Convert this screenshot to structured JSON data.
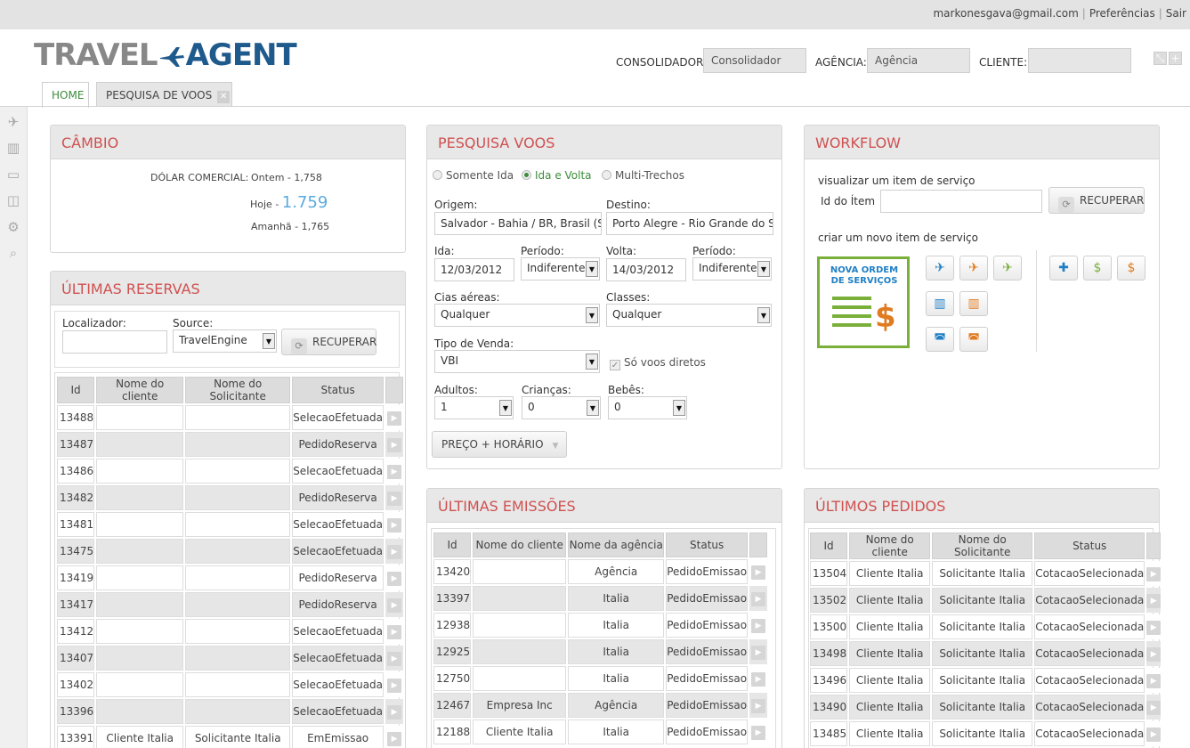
{
  "topbar": {
    "email": "markonesgava@gmail.com",
    "prefs": "Preferências",
    "logout": "Sair"
  },
  "logo": {
    "part1": "TRAVEL",
    "part2": "AGENT"
  },
  "filters": {
    "consolidador_label": "CONSOLIDADOR:",
    "consolidador_value": "Consolidador",
    "agencia_label": "AGÊNCIA:",
    "agencia_value": "Agência",
    "cliente_label": "CLIENTE:",
    "cliente_value": ""
  },
  "tabs": [
    {
      "label": "HOME"
    },
    {
      "label": "PESQUISA DE VOOS"
    }
  ],
  "cambio": {
    "title": "CÂMBIO",
    "label": "DÓLAR COMERCIAL:",
    "ontem": "Ontem - 1,758",
    "hoje_prefix": "Hoje -",
    "hoje_value": "1.759",
    "amanha": "Amanhã - 1,765"
  },
  "reservas": {
    "title": "ÚLTIMAS RESERVAS",
    "localizador_label": "Localizador:",
    "localizador_value": "",
    "source_label": "Source:",
    "source_value": "TravelEngine",
    "recuperar": "RECUPERAR",
    "columns": [
      "Id",
      "Nome do cliente",
      "Nome do Solicitante",
      "Status"
    ],
    "rows": [
      [
        "13488",
        "",
        "",
        "SelecaoEfetuada"
      ],
      [
        "13487",
        "",
        "",
        "PedidoReserva"
      ],
      [
        "13486",
        "",
        "",
        "SelecaoEfetuada"
      ],
      [
        "13482",
        "",
        "",
        "PedidoReserva"
      ],
      [
        "13481",
        "",
        "",
        "SelecaoEfetuada"
      ],
      [
        "13475",
        "",
        "",
        "SelecaoEfetuada"
      ],
      [
        "13419",
        "",
        "",
        "PedidoReserva"
      ],
      [
        "13417",
        "",
        "",
        "PedidoReserva"
      ],
      [
        "13412",
        "",
        "",
        "SelecaoEfetuada"
      ],
      [
        "13407",
        "",
        "",
        "SelecaoEfetuada"
      ],
      [
        "13402",
        "",
        "",
        "SelecaoEfetuada"
      ],
      [
        "13396",
        "",
        "",
        "SelecaoEfetuada"
      ],
      [
        "13391",
        "Cliente Italia",
        "Solicitante Italia",
        "EmEmissao"
      ]
    ]
  },
  "pesquisa": {
    "title": "PESQUISA VOOS",
    "trip_types": [
      "Somente Ida",
      "Ida e Volta",
      "Multi-Trechos"
    ],
    "origem_label": "Origem:",
    "origem_value": "Salvador - Bahia / BR, Brasil (SSA)",
    "destino_label": "Destino:",
    "destino_value": "Porto Alegre - Rio Grande do Sul",
    "ida_label": "Ida:",
    "ida_value": "12/03/2012",
    "periodo_label": "Período:",
    "periodo_value": "Indiferente",
    "volta_label": "Volta:",
    "volta_value": "14/03/2012",
    "periodo2_label": "Período:",
    "periodo2_value": "Indiferente",
    "cias_label": "Cias aéreas:",
    "cias_value": "Qualquer",
    "classes_label": "Classes:",
    "classes_value": "Qualquer",
    "tipo_label": "Tipo de Venda:",
    "tipo_value": "VBI",
    "diretos_label": "Só voos diretos",
    "adultos_label": "Adultos:",
    "adultos_value": "1",
    "criancas_label": "Crianças:",
    "criancas_value": "0",
    "bebes_label": "Bebês:",
    "bebes_value": "0",
    "search_button": "PREÇO + HORÁRIO"
  },
  "workflow": {
    "title": "WORKFLOW",
    "visualizar": "visualizar um item de serviço",
    "id_label": "Id do Ítem",
    "id_value": "",
    "recuperar": "RECUPERAR",
    "criar": "criar um novo item de serviço",
    "nova_ordem": "NOVA ORDEM DE SERVIÇOS"
  },
  "emissoes": {
    "title": "ÚLTIMAS EMISSÕES",
    "columns": [
      "Id",
      "Nome do cliente",
      "Nome da agência",
      "Status"
    ],
    "rows": [
      [
        "13420",
        "",
        "Agência",
        "PedidoEmissao"
      ],
      [
        "13397",
        "",
        "Italia",
        "PedidoEmissao"
      ],
      [
        "12938",
        "",
        "Italia",
        "PedidoEmissao"
      ],
      [
        "12925",
        "",
        "Italia",
        "PedidoEmissao"
      ],
      [
        "12750",
        "",
        "Italia",
        "PedidoEmissao"
      ],
      [
        "12467",
        "Empresa Inc",
        "Agência",
        "PedidoEmissao"
      ],
      [
        "12188",
        "Cliente Italia",
        "Italia",
        "PedidoEmissao"
      ]
    ]
  },
  "pedidos": {
    "title": "ÚLTIMOS PEDIDOS",
    "columns": [
      "Id",
      "Nome do cliente",
      "Nome do Solicitante",
      "Status"
    ],
    "rows": [
      [
        "13504",
        "Cliente Italia",
        "Solicitante Italia",
        "CotacaoSelecionada"
      ],
      [
        "13502",
        "Cliente Italia",
        "Solicitante Italia",
        "CotacaoSelecionada"
      ],
      [
        "13500",
        "Cliente Italia",
        "Solicitante Italia",
        "CotacaoSelecionada"
      ],
      [
        "13498",
        "Cliente Italia",
        "Solicitante Italia",
        "CotacaoSelecionada"
      ],
      [
        "13496",
        "Cliente Italia",
        "Solicitante Italia",
        "CotacaoSelecionada"
      ],
      [
        "13490",
        "Cliente Italia",
        "Solicitante Italia",
        "CotacaoSelecionada"
      ],
      [
        "13485",
        "Cliente Italia",
        "Solicitante Italia",
        "CotacaoSelecionada"
      ]
    ]
  },
  "colors": {
    "accent_red": "#d05050",
    "accent_green": "#3c8c3c",
    "logo_blue": "#1f5a8c",
    "link_blue": "#5aabe0"
  }
}
